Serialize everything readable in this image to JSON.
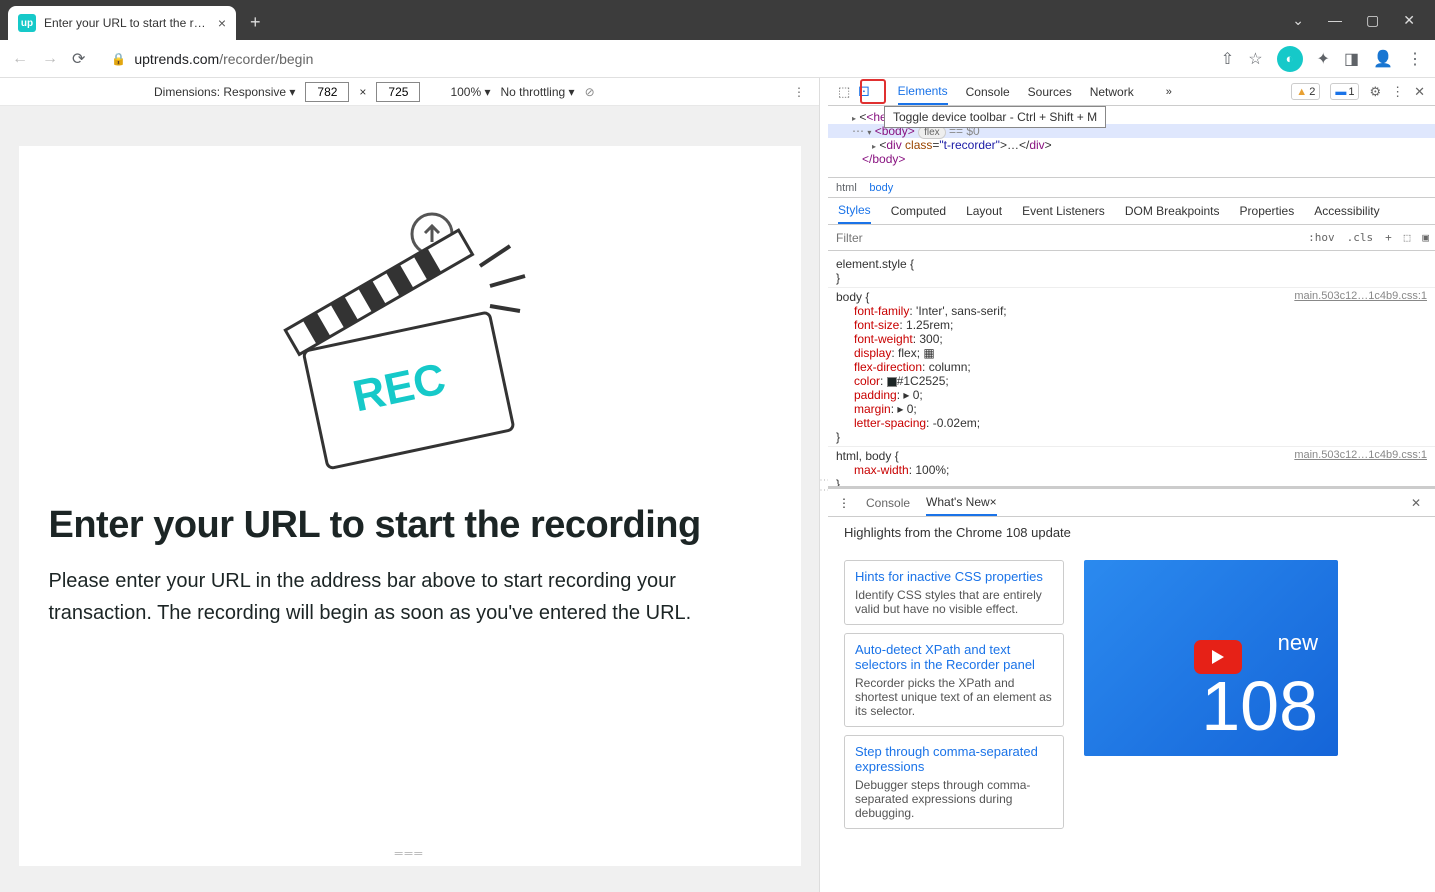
{
  "browser": {
    "tab_title": "Enter your URL to start the recor",
    "url_host": "uptrends.com",
    "url_path": "/recorder/begin"
  },
  "device_toolbar": {
    "dimensions_label": "Dimensions: Responsive",
    "width": "782",
    "height": "725",
    "zoom": "100%",
    "throttle": "No throttling"
  },
  "tooltip": "Toggle device toolbar - Ctrl + Shift + M",
  "page": {
    "rec": "REC",
    "heading": "Enter your URL to start the recording",
    "body": "Please enter your URL in the address bar above to start recording your transaction. The recording will begin as soon as you've entered the URL."
  },
  "devtools": {
    "tabs": [
      "Elements",
      "Console",
      "Sources",
      "Network"
    ],
    "warn_count": "2",
    "info_count": "1",
    "dom_head": "<hea",
    "dom_body_open": "<body>",
    "dom_flex": "flex",
    "dom_eq": "== $0",
    "dom_div": "<div class=\"t-recorder\">…</div>",
    "dom_body_close": "</body>",
    "breadcrumb": [
      "html",
      "body"
    ],
    "styles_tabs": [
      "Styles",
      "Computed",
      "Layout",
      "Event Listeners",
      "DOM Breakpoints",
      "Properties",
      "Accessibility"
    ],
    "filter_placeholder": "Filter",
    "filter_btns": [
      ":hov",
      ".cls",
      "+"
    ],
    "css_link": "main.503c12…1c4b9.css:1",
    "rules": {
      "element_style": "element.style {",
      "body_open": "body {",
      "font_family": "font-family: 'Inter', sans-serif;",
      "font_size": "font-size: 1.25rem;",
      "font_weight": "font-weight: 300;",
      "display": "display: flex;",
      "flex_dir": "flex-direction: column;",
      "color_prop": "color:",
      "color_val": "#1C2525;",
      "padding": "padding: ▸ 0;",
      "margin": "margin: ▸ 0;",
      "letter": "letter-spacing: -0.02em;",
      "close": "}",
      "html_body": "html, body {",
      "maxw": "max-width: 100%;",
      "star": "* {"
    }
  },
  "drawer": {
    "tabs": [
      "Console",
      "What's New"
    ],
    "highlights": "Highlights from the Chrome 108 update",
    "cards": [
      {
        "title": "Hints for inactive CSS properties",
        "desc": "Identify CSS styles that are entirely valid but have no visible effect."
      },
      {
        "title": "Auto-detect XPath and text selectors in the Recorder panel",
        "desc": "Recorder picks the XPath and shortest unique text of an element as its selector."
      },
      {
        "title": "Step through comma-separated expressions",
        "desc": "Debugger steps through comma-separated expressions during debugging."
      }
    ],
    "promo_new": "new",
    "promo_num": "108"
  }
}
